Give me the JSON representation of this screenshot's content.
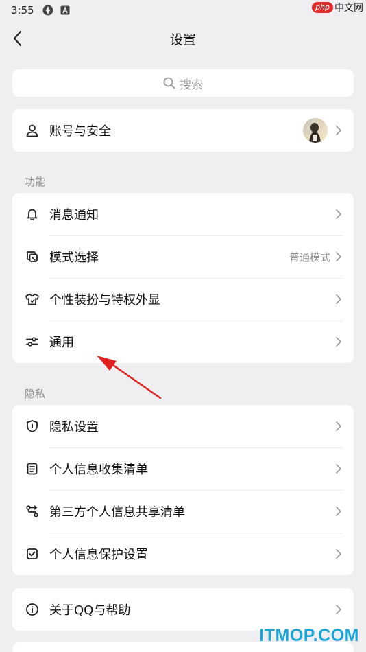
{
  "status_bar": {
    "time": "3:55"
  },
  "watermark_top": {
    "php": "php",
    "cn": "中文网"
  },
  "header": {
    "title": "设置"
  },
  "search": {
    "placeholder": "搜索"
  },
  "account": {
    "label": "账号与安全"
  },
  "section_features": {
    "title": "功能",
    "items": [
      {
        "label": "消息通知",
        "icon": "bell-icon"
      },
      {
        "label": "模式选择",
        "value": "普通模式",
        "icon": "mode-icon"
      },
      {
        "label": "个性装扮与特权外显",
        "icon": "shirt-icon"
      },
      {
        "label": "通用",
        "icon": "sliders-icon"
      }
    ]
  },
  "section_privacy": {
    "title": "隐私",
    "items": [
      {
        "label": "隐私设置",
        "icon": "shield-icon"
      },
      {
        "label": "个人信息收集清单",
        "icon": "document-icon"
      },
      {
        "label": "第三方个人信息共享清单",
        "icon": "share-icon"
      },
      {
        "label": "个人信息保护设置",
        "icon": "checkbox-icon"
      }
    ]
  },
  "about": {
    "label": "关于QQ与帮助",
    "icon": "info-icon"
  },
  "watermark_bottom": "ITMOP.COM",
  "colors": {
    "background": "#efeff1",
    "card": "#ffffff",
    "arrow": "#e02020",
    "watermark": "#1aa7d8"
  }
}
